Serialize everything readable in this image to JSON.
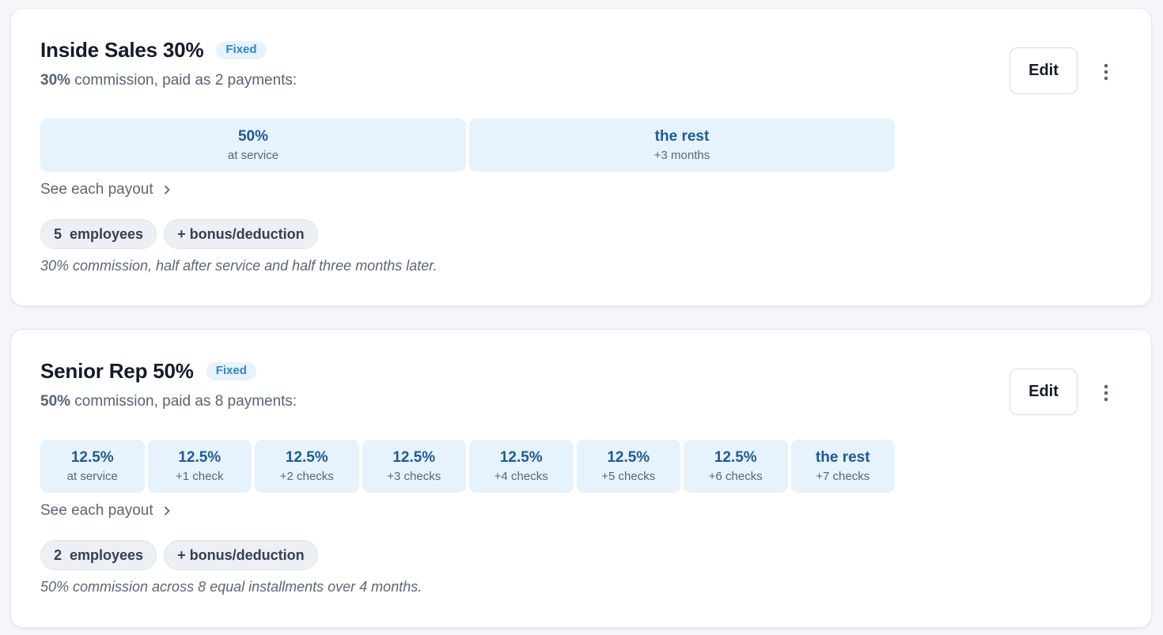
{
  "colors": {
    "page_bg": "#f4f6f9",
    "card_bg": "#ffffff",
    "badge_bg": "#e6f2fc",
    "badge_text": "#2f86cc",
    "segment_bg": "#e6f2fc",
    "segment_value": "#1f5a96",
    "chip_bg": "#eceff3"
  },
  "plans": [
    {
      "title": "Inside Sales 30%",
      "type_badge": "Fixed",
      "summary_pct": "30%",
      "summary_text": " commission, paid as 2 payments:",
      "edit_label": "Edit",
      "more_icon": "more-vertical-icon",
      "segments": [
        {
          "value": "50%",
          "label": "at service"
        },
        {
          "value": "the rest",
          "label": "+3 months"
        }
      ],
      "see_payout_label": "See each payout",
      "employee_count": "5",
      "employees_label": "employees",
      "bonus_label": "+ bonus/deduction",
      "description": "30% commission, half after service and half three months later."
    },
    {
      "title": "Senior Rep 50%",
      "type_badge": "Fixed",
      "summary_pct": "50%",
      "summary_text": " commission, paid as 8 payments:",
      "edit_label": "Edit",
      "more_icon": "more-vertical-icon",
      "segments": [
        {
          "value": "12.5%",
          "label": "at service"
        },
        {
          "value": "12.5%",
          "label": "+1 check"
        },
        {
          "value": "12.5%",
          "label": "+2 checks"
        },
        {
          "value": "12.5%",
          "label": "+3 checks"
        },
        {
          "value": "12.5%",
          "label": "+4 checks"
        },
        {
          "value": "12.5%",
          "label": "+5 checks"
        },
        {
          "value": "12.5%",
          "label": "+6 checks"
        },
        {
          "value": "the rest",
          "label": "+7 checks"
        }
      ],
      "see_payout_label": "See each payout",
      "employee_count": "2",
      "employees_label": "employees",
      "bonus_label": "+ bonus/deduction",
      "description": "50% commission across 8 equal installments over 4 months."
    }
  ]
}
